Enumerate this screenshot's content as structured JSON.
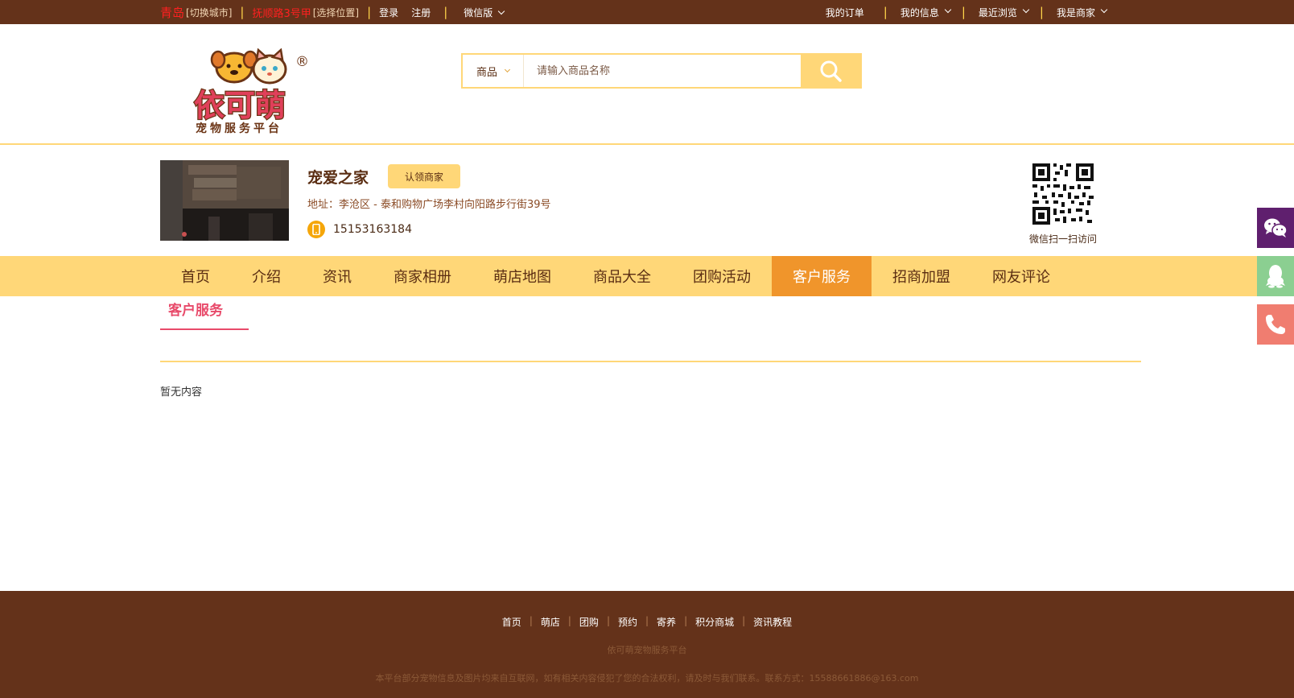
{
  "topbar": {
    "city": "青岛",
    "switch_city": "[切换城市]",
    "location": "抚顺路3号甲",
    "choose_location": "[选择位置]",
    "login": "登录",
    "register": "注册",
    "wechat": "微信版",
    "my_orders": "我的订单",
    "my_info": "我的信息",
    "recent": "最近浏览",
    "merchant": "我是商家"
  },
  "logo": {
    "name": "依可萌",
    "tagline": "宠物服务平台",
    "registered": "®"
  },
  "search": {
    "category": "商品",
    "placeholder": "请输入商品名称"
  },
  "store": {
    "name": "宠爱之家",
    "claim_label": "认领商家",
    "address": "地址：李沧区 - 泰和购物广场李村向阳路步行街39号",
    "phone": "15153163184",
    "qr_label": "微信扫一扫访问"
  },
  "nav": {
    "items": [
      {
        "label": "首页"
      },
      {
        "label": "介绍"
      },
      {
        "label": "资讯"
      },
      {
        "label": "商家相册"
      },
      {
        "label": "萌店地图"
      },
      {
        "label": "商品大全"
      },
      {
        "label": "团购活动"
      },
      {
        "label": "客户服务"
      },
      {
        "label": "招商加盟"
      },
      {
        "label": "网友评论"
      }
    ],
    "active": "客户服务"
  },
  "content": {
    "section_title": "客户服务",
    "empty_text": "暂无内容"
  },
  "footer": {
    "links": [
      "首页",
      "萌店",
      "团购",
      "预约",
      "寄养",
      "积分商城",
      "资讯教程"
    ],
    "site_name": "依可萌宠物服务平台",
    "note": "本平台部分宠物信息及图片均来自互联网，如有相关内容侵犯了您的合法权利，请及时与我们联系。联系方式：15588661886@163.com"
  },
  "colors": {
    "brown": "#64321a",
    "yellow": "#ffd778",
    "orange_active": "#f0952b",
    "pink": "#e84a6a"
  }
}
